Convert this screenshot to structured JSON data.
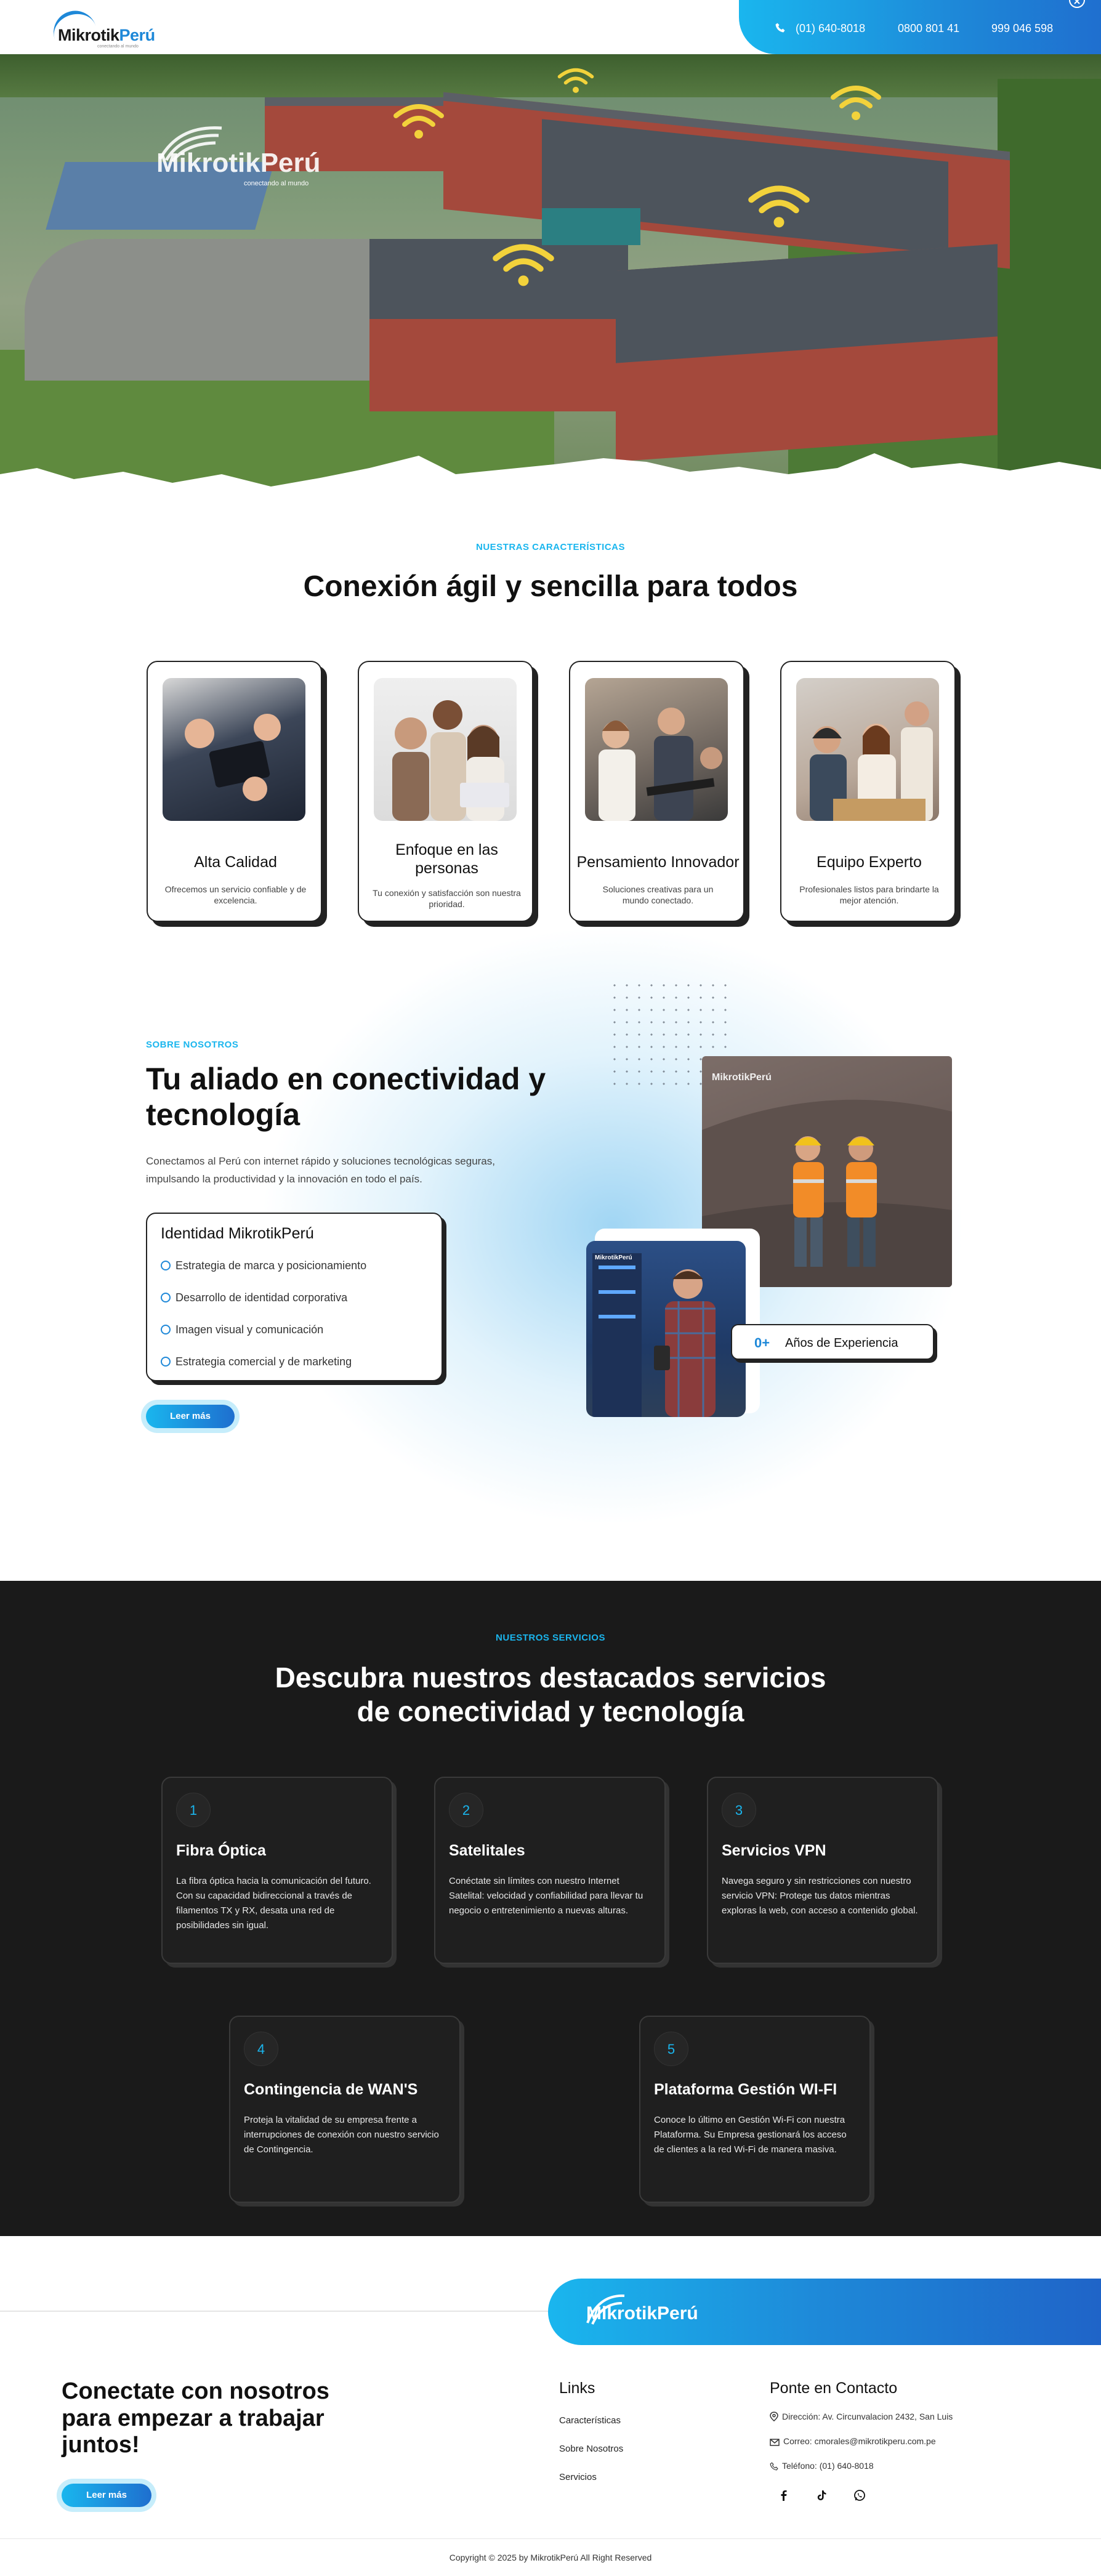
{
  "header": {
    "logo_main": "Mikrotik",
    "logo_accent": "Perú",
    "logo_tagline": "conectando al mundo",
    "phone1": "(01) 640-8018",
    "phone2": "0800 801 41",
    "phone3": "999 046 598"
  },
  "hero": {
    "logo_main": "Mikrotik",
    "logo_accent": "Perú",
    "logo_tagline": "conectando al mundo"
  },
  "features": {
    "eyebrow": "NUESTRAS CARACTERÍSTICAS",
    "title": "Conexión ágil y sencilla para todos",
    "cards": [
      {
        "title": "Alta Calidad",
        "desc": "Ofrecemos un servicio confiable y de excelencia."
      },
      {
        "title": "Enfoque en las personas",
        "desc": "Tu conexión y satisfacción son nuestra prioridad."
      },
      {
        "title": "Pensamiento Innovador",
        "desc": "Soluciones creativas para un mundo conectado."
      },
      {
        "title": "Equipo Experto",
        "desc": "Profesionales listos para brindarte la mejor atención."
      }
    ]
  },
  "about": {
    "eyebrow": "SOBRE NOSOTROS",
    "title": "Tu aliado en conectividad y tecnología",
    "paragraph": "Conectamos al Perú con internet rápido y soluciones tecnológicas seguras, impulsando la productividad y la innovación en todo el país.",
    "identity_title": "Identidad MikrotikPerú",
    "identity_items": [
      "Estrategia de marca y posicionamiento",
      "Desarrollo de identidad corporativa",
      "Imagen visual y comunicación",
      "Estrategia comercial y de marketing"
    ],
    "read_more": "Leer más",
    "years_value": "0+",
    "years_label": "Años de Experiencia",
    "photo_logo": "MikrotikPerú"
  },
  "services": {
    "eyebrow": "NUESTROS SERVICIOS",
    "title_line1": "Descubra nuestros destacados servicios",
    "title_line2": "de conectividad y tecnología",
    "cards": [
      {
        "num": "1",
        "title": "Fibra Óptica",
        "desc": "La fibra óptica hacia la comunicación del futuro. Con su capacidad bidireccional a través de filamentos TX y RX, desata una red de posibilidades sin igual."
      },
      {
        "num": "2",
        "title": "Satelitales",
        "desc": "Conéctate sin límites con nuestro Internet Satelital: velocidad y confiabilidad para llevar tu negocio o entretenimiento a nuevas alturas."
      },
      {
        "num": "3",
        "title": "Servicios VPN",
        "desc": "Navega seguro y sin restricciones con nuestro servicio VPN: Protege tus datos mientras exploras la web, con acceso a contenido global."
      },
      {
        "num": "4",
        "title": "Contingencia de WAN'S",
        "desc": "Proteja la vitalidad de su empresa frente a interrupciones de conexión con nuestro servicio de Contingencia."
      },
      {
        "num": "5",
        "title": "Plataforma Gestión WI-FI",
        "desc": "Conoce lo último en Gestión Wi-Fi con nuestra Plataforma. Su Empresa gestionará los acceso de clientes a la red Wi-Fi de manera masiva."
      }
    ]
  },
  "footer": {
    "logo_main": "Mikrotik",
    "logo_accent": "Perú",
    "cta_title": "Conectate con nosotros para empezar a trabajar juntos!",
    "cta_button": "Leer más",
    "links_title": "Links",
    "links": [
      "Características",
      "Sobre Nosotros",
      "Servicios"
    ],
    "contact_title": "Ponte en Contacto",
    "address": "Dirección: Av. Circunvalacion 2432, San Luis",
    "email": "Correo: cmorales@mikrotikperu.com.pe",
    "phone": "Teléfono: (01) 640-8018",
    "copyright": "Copyright © 2025 by MikrotikPerú All Right Reserved"
  }
}
